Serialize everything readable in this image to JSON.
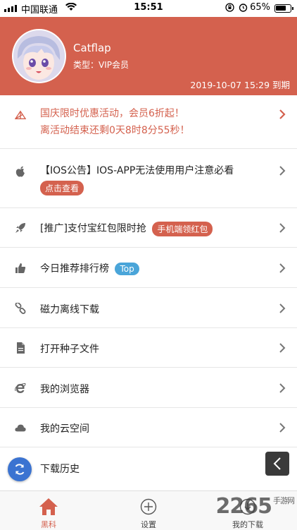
{
  "status_bar": {
    "carrier": "中国联通",
    "time": "15:51",
    "battery_percent": "65%"
  },
  "profile": {
    "username": "Catflap",
    "type": "类型：VIP会员",
    "expiry": "2019-10-07 15:29 到期"
  },
  "colors": {
    "accent": "#d4614e",
    "badge_blue": "#4aa5d9",
    "fab": "#3b73d1"
  },
  "promo": {
    "line1": "国庆限时优惠活动，会员6折起！",
    "line2": "离活动结束还剩0天8时8分55秒！",
    "icon": "logo-icon"
  },
  "menu": {
    "ios_notice": {
      "label": "【IOS公告】IOS-APP无法使用用户注意必看",
      "badge": "点击查看",
      "icon": "apple-icon"
    },
    "promotion": {
      "label": "[推广]支付宝红包限时抢",
      "badge": "手机端领红包",
      "icon": "rocket-icon"
    },
    "ranking": {
      "label": "今日推荐排行榜",
      "badge": "Top",
      "icon": "thumbs-up-icon"
    },
    "magnet": {
      "label": "磁力离线下载",
      "icon": "link-icon"
    },
    "torrent": {
      "label": "打开种子文件",
      "icon": "file-icon"
    },
    "browser": {
      "label": "我的浏览器",
      "icon": "ie-browser-icon"
    },
    "cloud": {
      "label": "我的云空间",
      "icon": "cloud-icon"
    },
    "history": {
      "label": "下载历史"
    }
  },
  "tabs": [
    {
      "label": "黑科",
      "icon": "home-icon"
    },
    {
      "label": "设置",
      "icon": "plus-circle-icon"
    },
    {
      "label": "我的下载",
      "icon": "download-icon"
    }
  ],
  "watermark": {
    "number": "2265",
    "suffix": "手游网"
  }
}
